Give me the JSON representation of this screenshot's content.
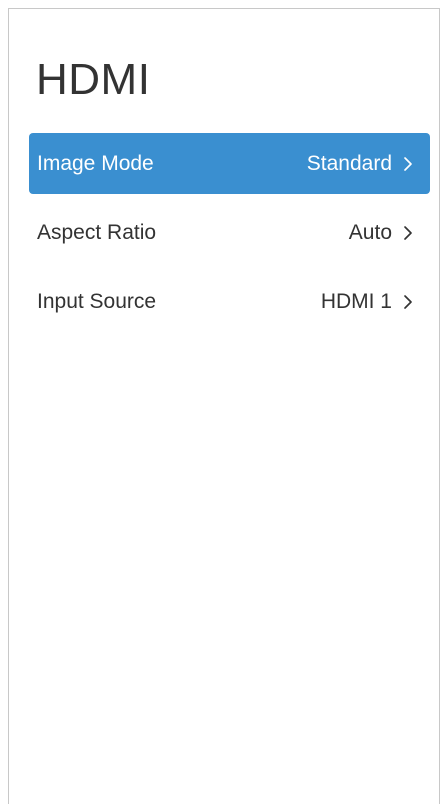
{
  "page": {
    "title": "HDMI"
  },
  "menu": {
    "items": [
      {
        "label": "Image Mode",
        "value": "Standard",
        "selected": true
      },
      {
        "label": "Aspect Ratio",
        "value": "Auto",
        "selected": false
      },
      {
        "label": "Input Source",
        "value": "HDMI 1",
        "selected": false
      }
    ]
  },
  "icons": {
    "chevron": "chevron-right-icon"
  },
  "colors": {
    "selected_background": "#3a8fd0",
    "text": "#333333",
    "selected_text": "#ffffff"
  }
}
